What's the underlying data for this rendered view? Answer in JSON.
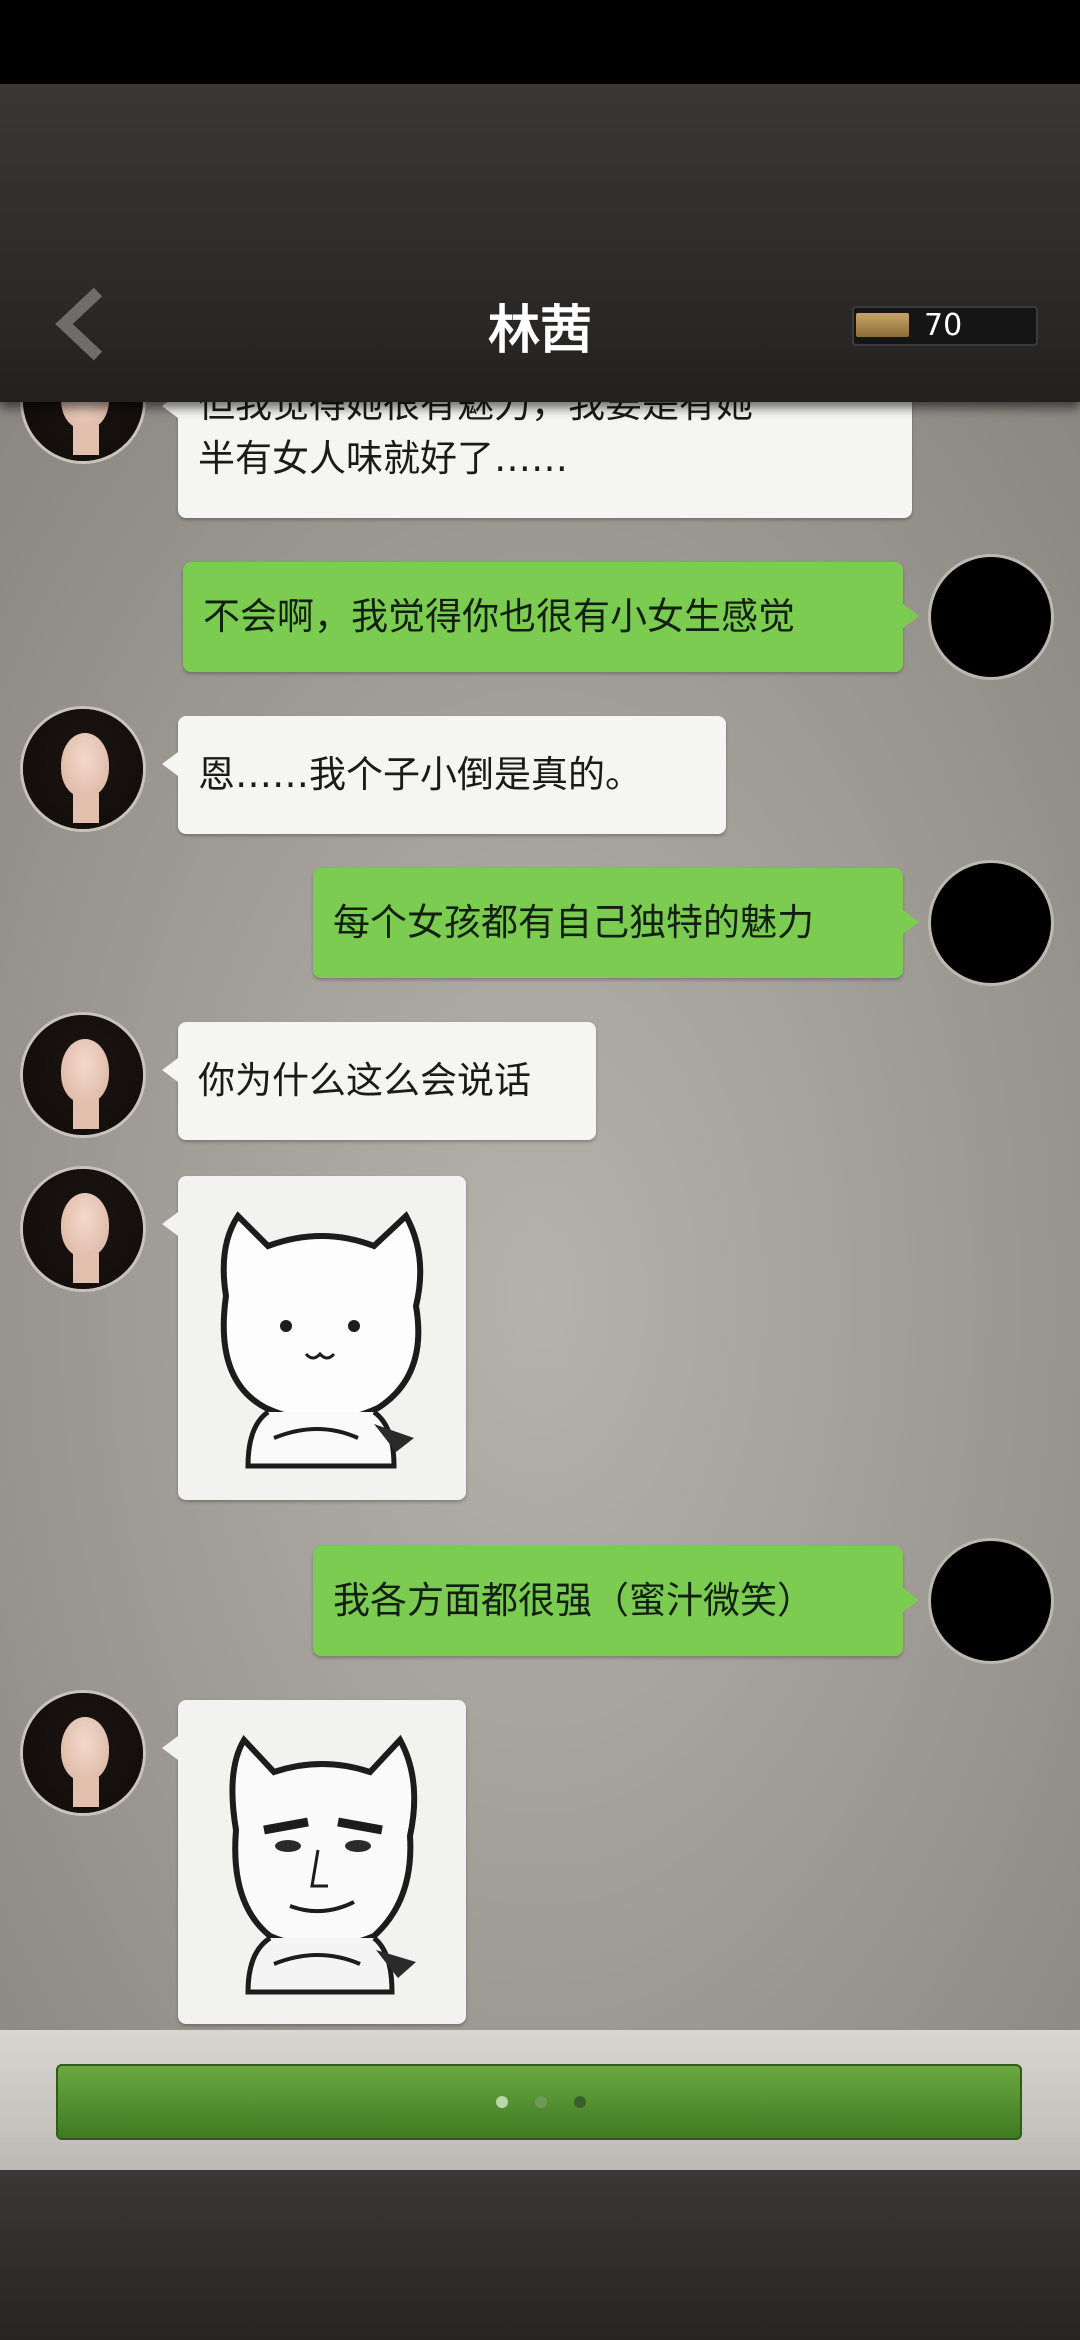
{
  "header": {
    "title": "林茜",
    "energy_value": "70",
    "energy_fill_fraction": 0.3,
    "back_icon": "chevron-left-icon"
  },
  "messages": [
    {
      "side": "left",
      "type": "text",
      "text_lines": [
        "但我觉得她很有魅力，我要是有她",
        "半有女人味就好了……"
      ]
    },
    {
      "side": "right",
      "type": "text",
      "text": "不会啊，我觉得你也很有小女生感觉"
    },
    {
      "side": "left",
      "type": "text",
      "text": "恩……我个子小倒是真的。"
    },
    {
      "side": "right",
      "type": "text",
      "text": "每个女孩都有自己独特的魅力"
    },
    {
      "side": "left",
      "type": "text",
      "text": "你为什么这么会说话"
    },
    {
      "side": "left",
      "type": "sticker",
      "sticker": "shy-cat-sticker"
    },
    {
      "side": "right",
      "type": "text",
      "text": "我各方面都很强（蜜汁微笑）"
    },
    {
      "side": "left",
      "type": "sticker",
      "sticker": "smug-cat-sticker"
    }
  ],
  "continue_bar": {
    "page_dots": 3,
    "active_dot": 3
  },
  "colors": {
    "incoming_bubble": "#f5f5f3",
    "outgoing_bubble": "#7ccc52",
    "continue_button": "#4f8f2d"
  }
}
